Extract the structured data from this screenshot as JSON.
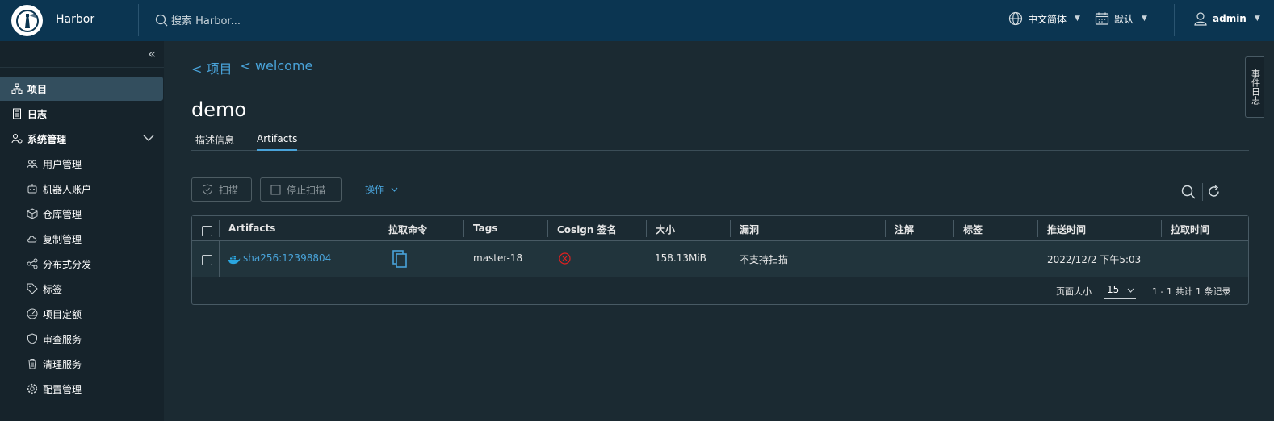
{
  "header": {
    "brand": "Harbor",
    "search_placeholder": "搜索 Harbor...",
    "language": "中文简体",
    "theme": "默认",
    "user": "admin"
  },
  "sidebar": {
    "items": [
      {
        "label": "项目",
        "icon": "projects-icon"
      },
      {
        "label": "日志",
        "icon": "logs-icon"
      },
      {
        "label": "系统管理",
        "icon": "admin-icon"
      },
      {
        "label": "用户管理",
        "icon": "users-icon"
      },
      {
        "label": "机器人账户",
        "icon": "robot-icon"
      },
      {
        "label": "仓库管理",
        "icon": "registry-icon"
      },
      {
        "label": "复制管理",
        "icon": "replication-icon"
      },
      {
        "label": "分布式分发",
        "icon": "distribution-icon"
      },
      {
        "label": "标签",
        "icon": "tag-icon"
      },
      {
        "label": "项目定额",
        "icon": "quota-icon"
      },
      {
        "label": "审查服务",
        "icon": "shield-icon"
      },
      {
        "label": "清理服务",
        "icon": "trash-icon"
      },
      {
        "label": "配置管理",
        "icon": "gear-icon"
      }
    ]
  },
  "breadcrumb": [
    "< 项目",
    "< welcome"
  ],
  "page_title": "demo",
  "tabs": [
    "描述信息",
    "Artifacts"
  ],
  "toolbar": {
    "scan": "扫描",
    "stop_scan": "停止扫描",
    "actions": "操作"
  },
  "table": {
    "columns": [
      "Artifacts",
      "拉取命令",
      "Tags",
      "Cosign 签名",
      "大小",
      "漏洞",
      "注解",
      "标签",
      "推送时间",
      "拉取时间"
    ],
    "rows": [
      {
        "artifact": "sha256:12398804",
        "tags": "master-18",
        "size": "158.13MiB",
        "vulnerabilities": "不支持扫描",
        "push_time": "2022/12/2 下午5:03",
        "pull_time": ""
      }
    ],
    "page_size_label": "页面大小",
    "page_size": "15",
    "summary": "1 - 1 共计 1 条记录"
  },
  "event_log": "事件日志",
  "colors": {
    "header": "#0b3551",
    "accent": "#49a3d9",
    "danger": "#e02020"
  }
}
